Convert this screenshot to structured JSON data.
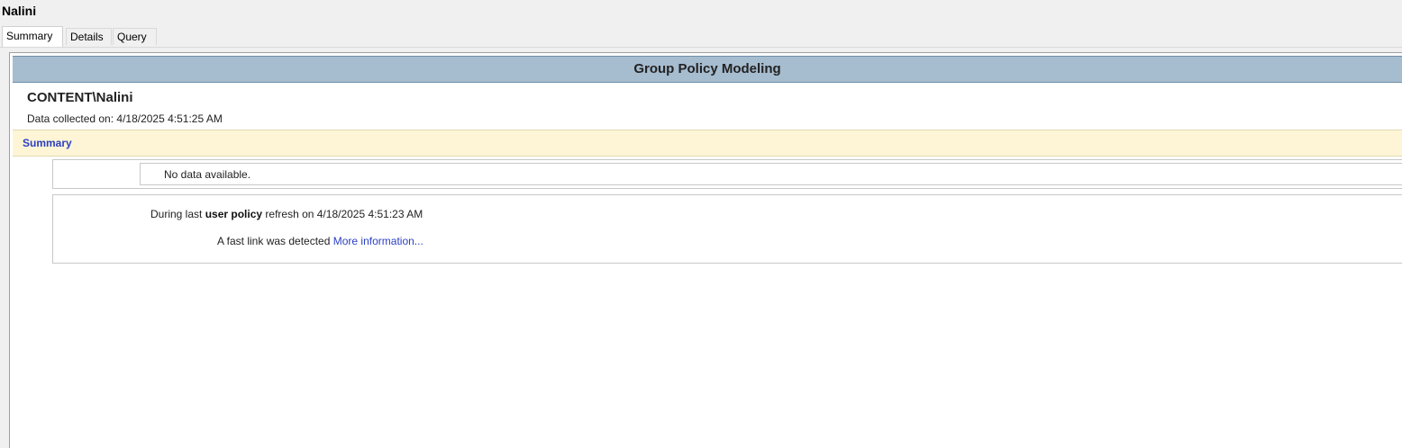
{
  "window": {
    "title": "Nalini"
  },
  "tabs": [
    {
      "label": "Summary",
      "active": true
    },
    {
      "label": "Details",
      "active": false
    },
    {
      "label": "Query",
      "active": false
    }
  ],
  "report": {
    "header": "Group Policy Modeling",
    "account": "CONTENT\\Nalini",
    "collected": "Data collected on: 4/18/2025 4:51:25 AM",
    "summary_label": "Summary",
    "no_data": "No data available.",
    "refresh": {
      "prefix": "During last ",
      "bold": "user policy",
      "suffix": " refresh on 4/18/2025 4:51:23 AM"
    },
    "fast_link": {
      "text": "A fast link was detected ",
      "link": "More information..."
    }
  },
  "colors": {
    "header_bg": "#a6bccf",
    "summary_bg": "#fdf5d6",
    "link": "#2b3fc4"
  }
}
